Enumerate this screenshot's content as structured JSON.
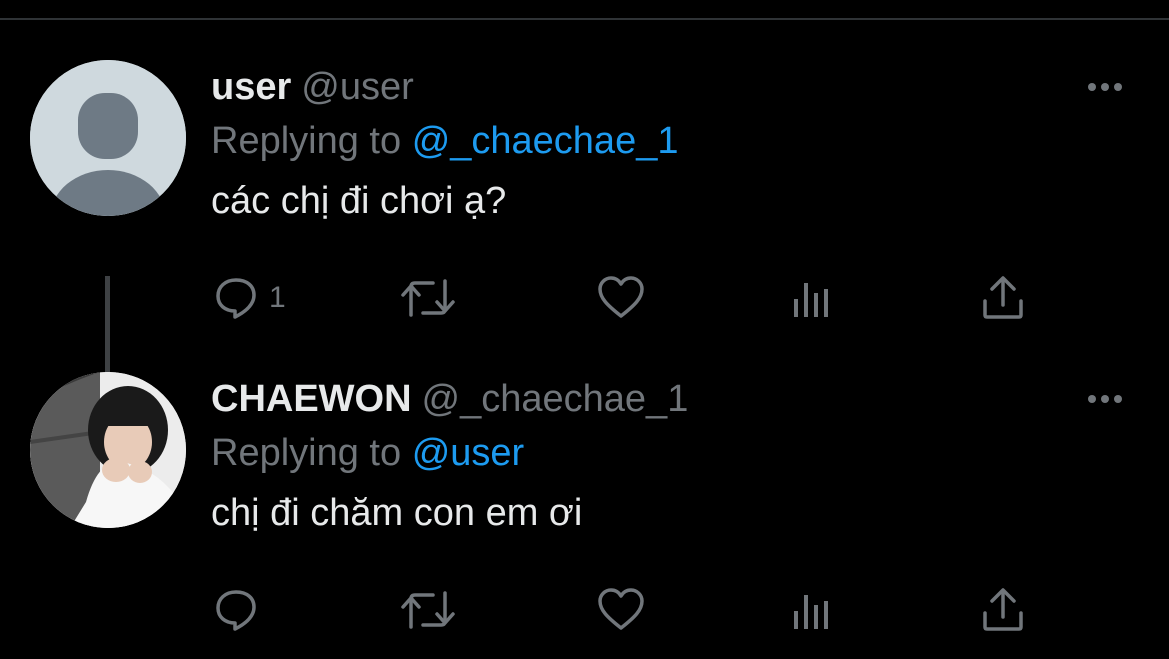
{
  "theme": {
    "background": "#000000",
    "text_primary": "#e7e9ea",
    "text_secondary": "#71767b",
    "accent": "#1d9bf0"
  },
  "thread": {
    "tweets": [
      {
        "display_name": "user",
        "handle": "@user",
        "replying_prefix": "Replying to",
        "replying_to": "@_chaechae_1",
        "text": "các chị đi chơi ạ?",
        "avatar": "default-avatar",
        "actions": {
          "reply_icon": "comment-icon",
          "reply_count": "1",
          "retweet_icon": "retweet-icon",
          "like_icon": "heart-icon",
          "views_icon": "analytics-icon",
          "share_icon": "share-icon"
        }
      },
      {
        "display_name": "CHAEWON",
        "handle": "@_chaechae_1",
        "replying_prefix": "Replying to",
        "replying_to": "@user",
        "text": "chị đi chăm con em ơi",
        "avatar": "profile-photo",
        "actions": {
          "reply_icon": "comment-icon",
          "reply_count": "",
          "retweet_icon": "retweet-icon",
          "like_icon": "heart-icon",
          "views_icon": "analytics-icon",
          "share_icon": "share-icon"
        }
      }
    ]
  }
}
